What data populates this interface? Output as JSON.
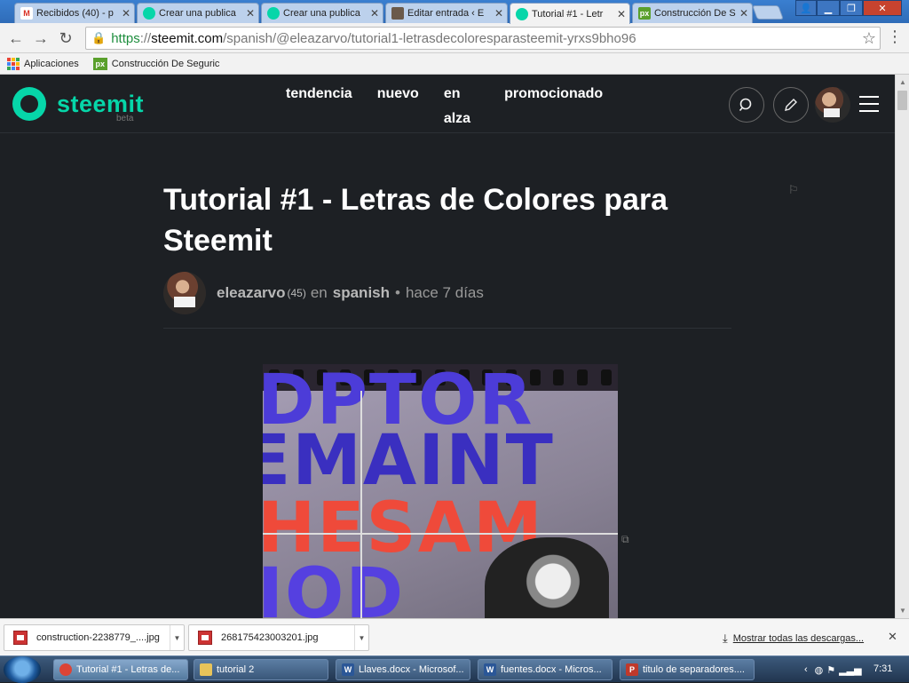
{
  "browser": {
    "tabs": [
      {
        "label": "Recibidos (40) - p",
        "icon": "gmail-icon",
        "color": "#d93025",
        "glyph": "M"
      },
      {
        "label": "Crear una publica",
        "icon": "steemit-icon",
        "color": "#06d6a9",
        "glyph": ""
      },
      {
        "label": "Crear una publica",
        "icon": "steemit-icon",
        "color": "#06d6a9",
        "glyph": ""
      },
      {
        "label": "Editar entrada ‹ E",
        "icon": "person-icon",
        "color": "#6b5a4a",
        "glyph": ""
      },
      {
        "label": "Tutorial #1 - Letr",
        "icon": "steemit-icon",
        "color": "#06d6a9",
        "glyph": ""
      },
      {
        "label": "Construcción De S",
        "icon": "px-icon",
        "color": "#5aa02c",
        "glyph": "px"
      }
    ],
    "url": {
      "https": "https",
      "sep": "://",
      "host": "steemit.com",
      "path": "/spanish/@eleazarvo/tutorial1-letrasdecoloresparasteemit-yrxs9bho96"
    },
    "bookmarks": {
      "apps": "Aplicaciones",
      "site": "Construcción De Seguric"
    }
  },
  "site": {
    "logo": "steemit",
    "beta": "beta",
    "nav": [
      {
        "label": "tendencia"
      },
      {
        "label": "nuevo"
      },
      {
        "label": "en\nalza"
      },
      {
        "label": "promocionado"
      }
    ]
  },
  "post": {
    "title": "Tutorial #1 - Letras de Colores para Steemit",
    "author": "eleazarvo",
    "reputation": "(45)",
    "in": "en",
    "category": "spanish",
    "bullet": "•",
    "time": "hace 7 días",
    "hero_words": [
      "DPTOR",
      "EMAINT",
      "HESAM",
      "IOD"
    ]
  },
  "downloads": {
    "items": [
      {
        "name": "construction-2238779_....jpg"
      },
      {
        "name": "268175423003201.jpg"
      }
    ],
    "show_all": "Mostrar todas las descargas..."
  },
  "taskbar": {
    "items": [
      {
        "label": "Tutorial #1 - Letras de...",
        "icon": "chrome-icon",
        "color": "#db4437",
        "glyph": ""
      },
      {
        "label": "tutorial 2",
        "icon": "folder-icon",
        "color": "#e8c45a",
        "glyph": ""
      },
      {
        "label": "Llaves.docx - Microsof...",
        "icon": "word-icon",
        "color": "#2b5797",
        "glyph": "W"
      },
      {
        "label": "fuentes.docx - Micros...",
        "icon": "word-icon",
        "color": "#2b5797",
        "glyph": "W"
      },
      {
        "label": "titulo de separadores....",
        "icon": "publisher-icon",
        "color": "#c0392b",
        "glyph": "P"
      }
    ],
    "clock": "7:31"
  },
  "colors": {
    "accent": "#06d6a9",
    "page_bg": "#1d2024"
  }
}
